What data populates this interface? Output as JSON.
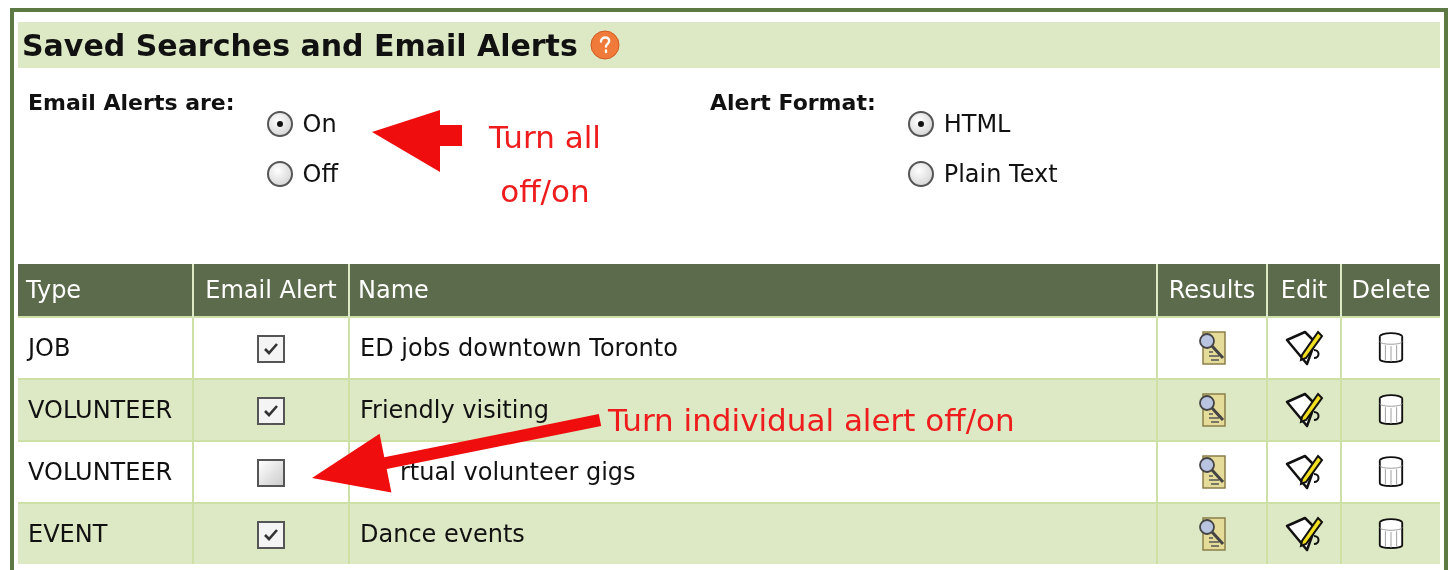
{
  "panel": {
    "title": "Saved Searches and Email Alerts"
  },
  "email_alerts": {
    "label": "Email Alerts are:",
    "options": [
      {
        "label": "On",
        "selected": true
      },
      {
        "label": "Off",
        "selected": false
      }
    ]
  },
  "alert_format": {
    "label": "Alert Format:",
    "options": [
      {
        "label": "HTML",
        "selected": true
      },
      {
        "label": "Plain Text",
        "selected": false
      }
    ]
  },
  "table": {
    "columns": [
      "Type",
      "Email Alert",
      "Name",
      "Results",
      "Edit",
      "Delete"
    ],
    "rows": [
      {
        "type": "JOB",
        "email_alert": true,
        "name": "ED jobs downtown Toronto"
      },
      {
        "type": "VOLUNTEER",
        "email_alert": true,
        "name": "Friendly visiting"
      },
      {
        "type": "VOLUNTEER",
        "email_alert": false,
        "name": "rtual volunteer gigs"
      },
      {
        "type": "EVENT",
        "email_alert": true,
        "name": "Dance events"
      }
    ]
  },
  "annotations": [
    {
      "text": "Turn all off/on"
    },
    {
      "text": "Turn individual alert off/on"
    }
  ]
}
